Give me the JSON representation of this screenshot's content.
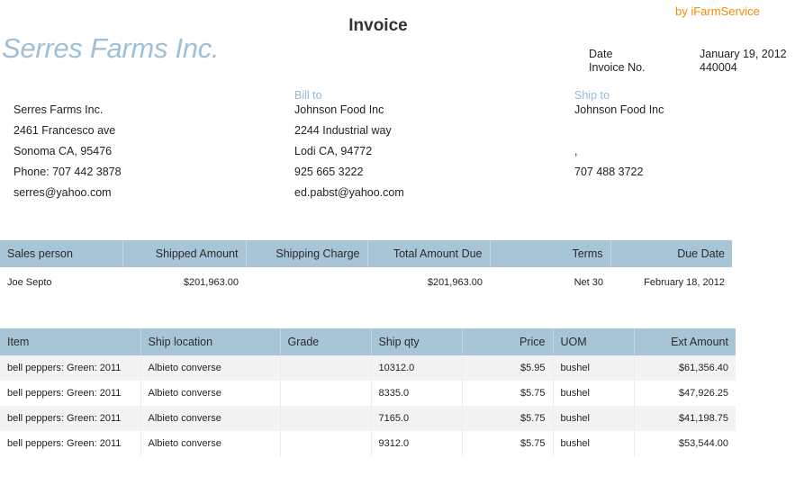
{
  "brand": "by iFarmService",
  "title": "Invoice",
  "company_name": "Serres Farms Inc.",
  "meta": {
    "date_label": "Date",
    "date_value": "January 19, 2012",
    "invoice_no_label": "Invoice No.",
    "invoice_no_value": "440004"
  },
  "from": {
    "lines": [
      "Serres Farms Inc.",
      "2461 Francesco ave",
      "Sonoma CA, 95476",
      "Phone: 707 442 3878",
      "serres@yahoo.com"
    ]
  },
  "bill_to": {
    "label": "Bill to",
    "lines": [
      "Johnson Food Inc",
      "2244 Industrial way",
      "Lodi CA, 94772",
      "925 665 3222",
      "ed.pabst@yahoo.com"
    ]
  },
  "ship_to": {
    "label": "Ship to",
    "lines": [
      "Johnson Food Inc",
      "",
      ",",
      "707 488 3722"
    ]
  },
  "sales_table": {
    "headers": [
      "Sales person",
      "Shipped Amount",
      "Shipping Charge",
      "Total Amount Due",
      "Terms",
      "Due Date"
    ],
    "row": [
      "Joe Septo",
      "$201,963.00",
      "",
      "$201,963.00",
      "Net 30",
      "February 18, 2012"
    ]
  },
  "items_table": {
    "headers": [
      "Item",
      "Ship location",
      "Grade",
      "Ship qty",
      "Price",
      "UOM",
      "Ext Amount"
    ],
    "rows": [
      [
        "bell peppers: Green: 2011",
        "Albieto converse",
        "",
        "10312.0",
        "$5.95",
        "bushel",
        "$61,356.40"
      ],
      [
        "bell peppers: Green: 2011",
        "Albieto converse",
        "",
        "8335.0",
        "$5.75",
        "bushel",
        "$47,926.25"
      ],
      [
        "bell peppers: Green: 2011",
        "Albieto converse",
        "",
        "7165.0",
        "$5.75",
        "bushel",
        "$41,198.75"
      ],
      [
        "bell peppers: Green: 2011",
        "Albieto converse",
        "",
        "9312.0",
        "$5.75",
        "bushel",
        "$53,544.00"
      ]
    ]
  },
  "colors": {
    "brand": "#f08c00",
    "company": "#9fbfd6",
    "header_bg": "#a7c5d7",
    "label_blue": "#94b9d3",
    "row_alt": "#f3f3f3"
  }
}
